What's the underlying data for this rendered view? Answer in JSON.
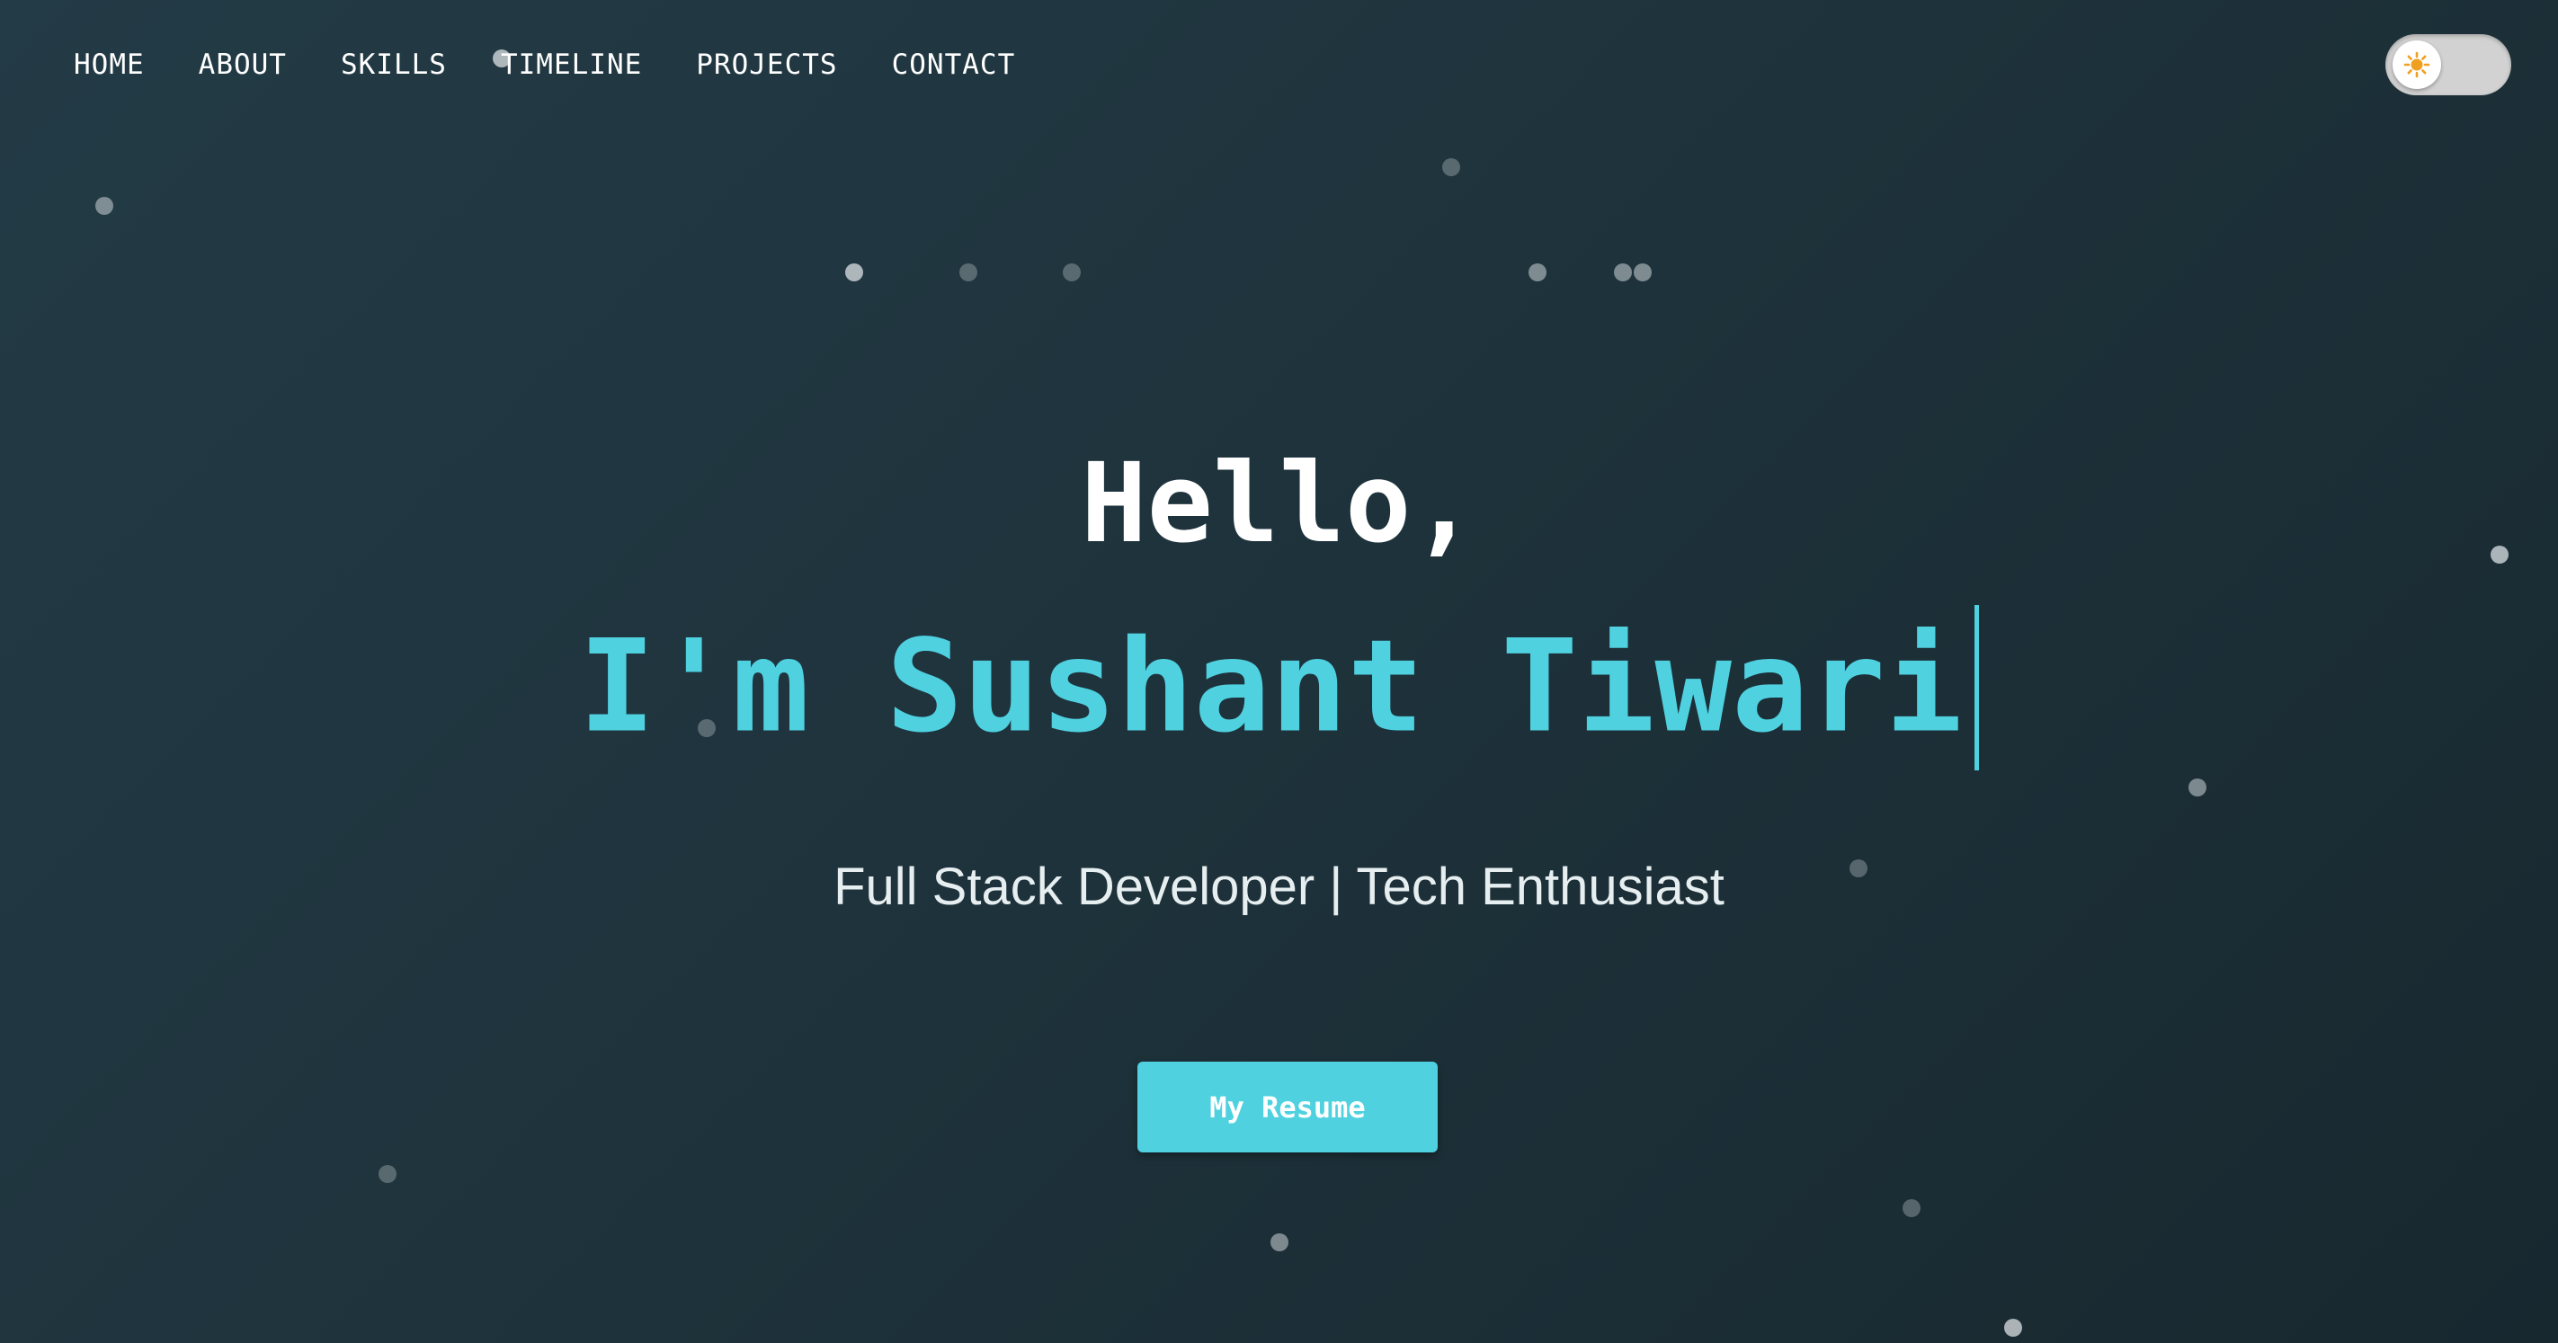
{
  "nav": {
    "items": [
      {
        "label": "HOME"
      },
      {
        "label": "ABOUT"
      },
      {
        "label": "SKILLS"
      },
      {
        "label": "TIMELINE"
      },
      {
        "label": "PROJECTS"
      },
      {
        "label": "CONTACT"
      }
    ]
  },
  "theme_toggle": {
    "icon": "sun-icon",
    "state": "light",
    "knob_color": "#ffffff",
    "track_color": "#d2d2d2",
    "icon_color": "#f0a020"
  },
  "hero": {
    "greeting": "Hello,",
    "name": "I'm Sushant Tiwari",
    "subtitle": "Full Stack Developer | Tech Enthusiast",
    "resume_label": "My Resume"
  },
  "colors": {
    "accent": "#4fd1e0",
    "background": "#1e323b",
    "text": "#ffffff"
  }
}
